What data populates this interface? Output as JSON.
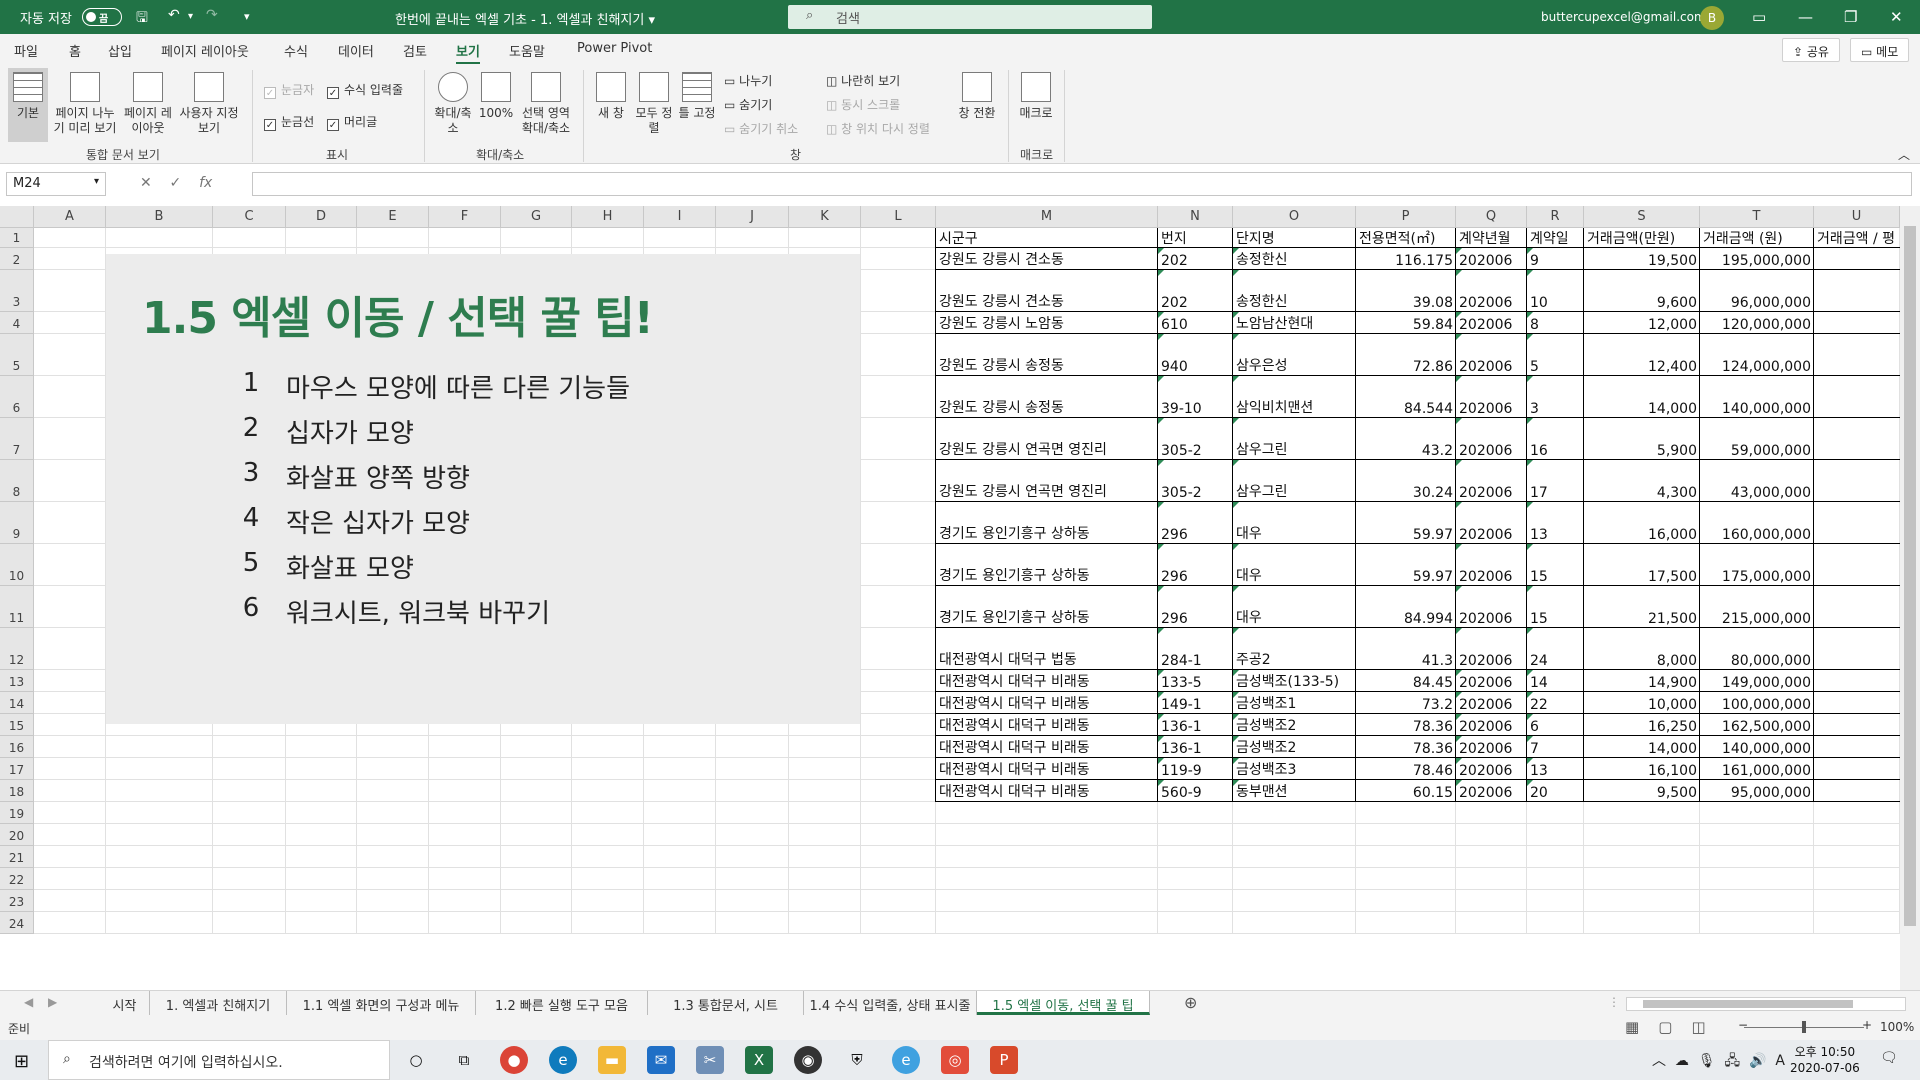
{
  "titlebar": {
    "autosave_label": "자동 저장",
    "autosave_state": "끔",
    "document_title": "한번에 끝내는 엑셀 기초 - 1. 엑셀과 친해지기",
    "search_placeholder": "검색",
    "account_email": "buttercupexcel@gmail.com",
    "user_initial": "B"
  },
  "menu": {
    "tabs": [
      "파일",
      "홈",
      "삽입",
      "페이지 레이아웃",
      "수식",
      "데이터",
      "검토",
      "보기",
      "도움말",
      "Power Pivot"
    ],
    "active_tab": "보기",
    "share_label": "공유",
    "memo_label": "메모"
  },
  "ribbon": {
    "workbook_views": {
      "label": "통합 문서 보기",
      "buttons": [
        "기본",
        "페이지 나누기 미리 보기",
        "페이지 레이아웃",
        "사용자 지정 보기"
      ]
    },
    "show": {
      "label": "표시",
      "ruler": "눈금자",
      "formula_bar": "수식 입력줄",
      "gridlines": "눈금선",
      "headings": "머리글"
    },
    "zoom": {
      "label": "확대/축소",
      "buttons": [
        "확대/축소",
        "100%",
        "선택 영역 확대/축소"
      ]
    },
    "window": {
      "label": "창",
      "buttons": [
        "새 창",
        "모두 정렬",
        "틀 고정"
      ],
      "split": "나누기",
      "hide": "숨기기",
      "unhide": "숨기기 취소",
      "side_by_side": "나란히 보기",
      "sync_scroll": "동시 스크롤",
      "reset_position": "창 위치 다시 정렬",
      "switch_windows": "창 전환"
    },
    "macros": {
      "label": "매크로",
      "button": "매크로"
    }
  },
  "formula_bar": {
    "name_box": "M24",
    "fx": "fx",
    "value": ""
  },
  "grid": {
    "columns": [
      "A",
      "B",
      "C",
      "D",
      "E",
      "F",
      "G",
      "H",
      "I",
      "J",
      "K",
      "L",
      "M",
      "N",
      "O",
      "P",
      "Q",
      "R",
      "S",
      "T",
      "U"
    ],
    "rows": [
      "1",
      "2",
      "3",
      "4",
      "5",
      "6",
      "7",
      "8",
      "9",
      "10",
      "11",
      "12",
      "13",
      "14",
      "15",
      "16",
      "17",
      "18",
      "19",
      "20",
      "21",
      "22",
      "23",
      "24"
    ]
  },
  "tips": {
    "title": "1.5 엑셀 이동 / 선택 꿀 팁!",
    "items": [
      {
        "num": "1",
        "text": "마우스 모양에 따른 다른 기능들"
      },
      {
        "num": "2",
        "text": "십자가 모양"
      },
      {
        "num": "3",
        "text": "화살표 양쪽 방향"
      },
      {
        "num": "4",
        "text": "작은 십자가 모양"
      },
      {
        "num": "5",
        "text": "화살표 모양"
      },
      {
        "num": "6",
        "text": "워크시트, 워크북 바꾸기"
      }
    ]
  },
  "table": {
    "headers": [
      "시군구",
      "번지",
      "단지명",
      "전용면적(㎡)",
      "계약년월",
      "계약일",
      "거래금액(만원)",
      "거래금액 (원)",
      "거래금액 / 평"
    ],
    "rows": [
      [
        "강원도 강릉시 견소동",
        "202",
        "송정한신",
        "116.175",
        "202006",
        "9",
        "19,500",
        "195,000,000"
      ],
      [
        "강원도 강릉시 견소동",
        "202",
        "송정한신",
        "39.08",
        "202006",
        "10",
        "9,600",
        "96,000,000"
      ],
      [
        "강원도 강릉시 노암동",
        "610",
        "노암남산현대",
        "59.84",
        "202006",
        "8",
        "12,000",
        "120,000,000"
      ],
      [
        "강원도 강릉시 송정동",
        "940",
        "삼우은성",
        "72.86",
        "202006",
        "5",
        "12,400",
        "124,000,000"
      ],
      [
        "강원도 강릉시 송정동",
        "39-10",
        "삼익비치맨션",
        "84.544",
        "202006",
        "3",
        "14,000",
        "140,000,000"
      ],
      [
        "강원도 강릉시 연곡면 영진리",
        "305-2",
        "삼우그린",
        "43.2",
        "202006",
        "16",
        "5,900",
        "59,000,000"
      ],
      [
        "강원도 강릉시 연곡면 영진리",
        "305-2",
        "삼우그린",
        "30.24",
        "202006",
        "17",
        "4,300",
        "43,000,000"
      ],
      [
        "경기도 용인기흥구 상하동",
        "296",
        "대우",
        "59.97",
        "202006",
        "13",
        "16,000",
        "160,000,000"
      ],
      [
        "경기도 용인기흥구 상하동",
        "296",
        "대우",
        "59.97",
        "202006",
        "15",
        "17,500",
        "175,000,000"
      ],
      [
        "경기도 용인기흥구 상하동",
        "296",
        "대우",
        "84.994",
        "202006",
        "15",
        "21,500",
        "215,000,000"
      ],
      [
        "대전광역시 대덕구 법동",
        "284-1",
        "주공2",
        "41.3",
        "202006",
        "24",
        "8,000",
        "80,000,000"
      ],
      [
        "대전광역시 대덕구 비래동",
        "133-5",
        "금성백조(133-5)",
        "84.45",
        "202006",
        "14",
        "14,900",
        "149,000,000"
      ],
      [
        "대전광역시 대덕구 비래동",
        "149-1",
        "금성백조1",
        "73.2",
        "202006",
        "22",
        "10,000",
        "100,000,000"
      ],
      [
        "대전광역시 대덕구 비래동",
        "136-1",
        "금성백조2",
        "78.36",
        "202006",
        "6",
        "16,250",
        "162,500,000"
      ],
      [
        "대전광역시 대덕구 비래동",
        "136-1",
        "금성백조2",
        "78.36",
        "202006",
        "7",
        "14,000",
        "140,000,000"
      ],
      [
        "대전광역시 대덕구 비래동",
        "119-9",
        "금성백조3",
        "78.46",
        "202006",
        "13",
        "16,100",
        "161,000,000"
      ],
      [
        "대전광역시 대덕구 비래동",
        "560-9",
        "동부맨션",
        "60.15",
        "202006",
        "20",
        "9,500",
        "95,000,000"
      ]
    ]
  },
  "sheet_tabs": {
    "tabs": [
      "시작",
      "1. 엑셀과 친해지기",
      "1.1 엑셀 화면의 구성과 메뉴",
      "1.2 빠른 실행 도구 모음",
      "1.3 통합문서, 시트",
      "1.4 수식 입력줄, 상태 표시줄",
      "1.5 엑셀 이동, 선택 꿀 팁"
    ],
    "active": "1.5 엑셀 이동, 선택 꿀 팁",
    "add_icon": "plus-icon"
  },
  "status": {
    "ready": "준비",
    "zoom": "100%"
  },
  "taskbar": {
    "search_placeholder": "검색하려면 여기에 입력하십시오.",
    "time": "오후 10:50",
    "date": "2020-07-06",
    "ime": "A"
  },
  "colors": {
    "accent": "#217346",
    "title_green": "#2e7d4f",
    "panel_gray": "#ececec"
  }
}
